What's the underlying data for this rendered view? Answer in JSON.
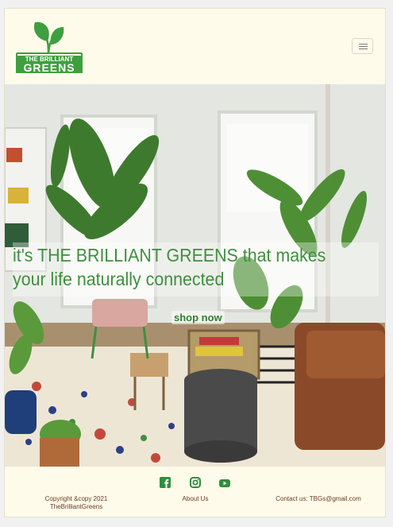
{
  "brand": {
    "logo_line1": "THE BRILLIANT",
    "logo_line2": "GREENS",
    "green": "#3f9f3f"
  },
  "nav": {
    "toggler_icon": "hamburger-menu-icon"
  },
  "hero": {
    "tagline": "it's THE BRILLIANT GREENS that makes your life naturally connected",
    "cta_label": "shop now"
  },
  "footer": {
    "social_icons": [
      "facebook-icon",
      "instagram-icon",
      "youtube-icon"
    ],
    "copyright_line1": "Copyright &copy 2021",
    "copyright_line2": "TheBrilliantGreens",
    "about_label": "About Us",
    "contact_label": "Contact us: TBGs@gmail.com",
    "text_color": "#6b3a1f",
    "icon_color": "#2f8f3f"
  }
}
